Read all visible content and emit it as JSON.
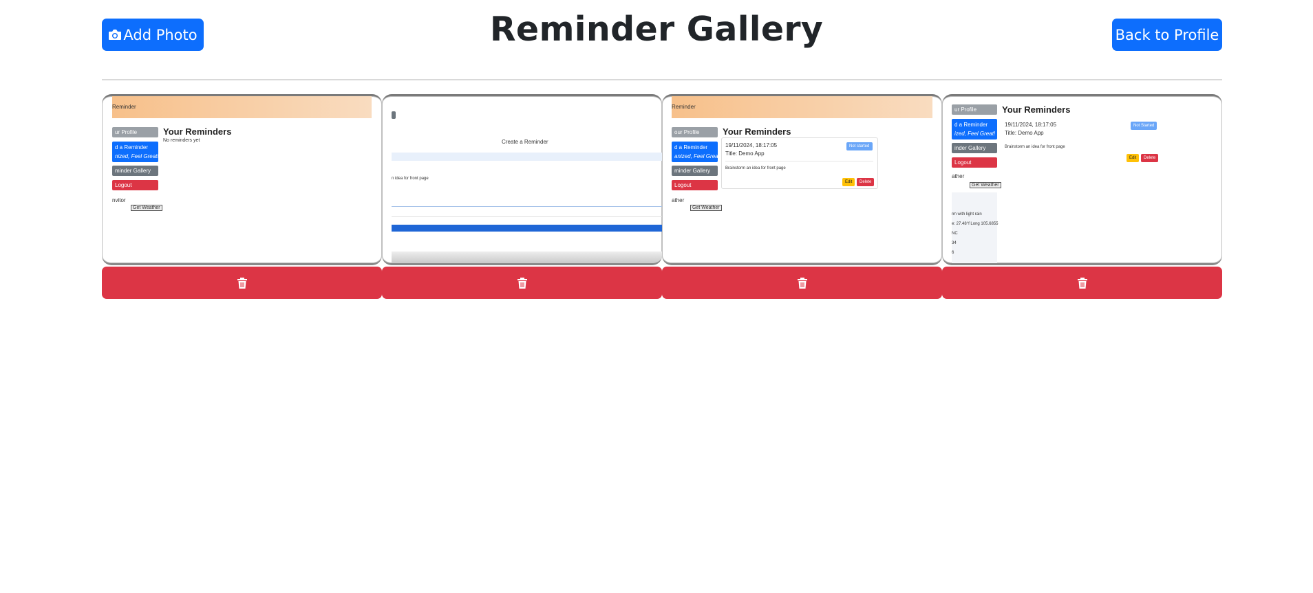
{
  "header": {
    "add_photo_label": "Add Photo",
    "title": "Reminder Gallery",
    "back_label": "Back to Profile"
  },
  "colors": {
    "primary": "#0d6efd",
    "danger": "#dc3545",
    "secondary": "#6c757d",
    "warning": "#ffc107"
  },
  "gallery": {
    "delete_icon": "trash-icon",
    "photos": [
      {
        "brand": "Reminder",
        "nav": [
          "ur Profile",
          "d a Reminder",
          "nized, Feel Great!",
          "minder Gallery",
          "Logout"
        ],
        "heading": "Your Reminders",
        "empty_text": "No reminders yet",
        "weather_label": "nvitor",
        "weather_btn": "Get Weather"
      },
      {
        "form_title": "Create a Reminder",
        "field_text": "n idea for front page"
      },
      {
        "brand": "Reminder",
        "nav": [
          "our Profile",
          "d a Reminder",
          "anized, Feel Great!",
          "minder Gallery",
          "Logout"
        ],
        "heading": "Your Reminders",
        "date": "19/11/2024, 18:17:05",
        "item_title": "Title: Demo App",
        "status": "Not started",
        "description": "Brainstorm an idea for front page",
        "edit": "Edit",
        "delete": "Delete",
        "weather_label": "ather",
        "weather_btn": "Get Weather"
      },
      {
        "nav": [
          "ur Profile",
          "d a Reminder",
          "ized, Feel Great!",
          "inder Gallery",
          "Logout"
        ],
        "heading": "Your Reminders",
        "date": "19/11/2024, 18:17:05",
        "item_title": "Title: Demo App",
        "status": "Not Started",
        "description": "Brainstorm an idea for front page",
        "edit": "Edit",
        "delete": "Delete",
        "weather_label": "ather",
        "weather_btn": "Get Weather",
        "extra_lines": [
          "rm with light rain",
          "e: 27.48°f Long 105.6855",
          "NC",
          "34",
          "6"
        ]
      }
    ]
  }
}
